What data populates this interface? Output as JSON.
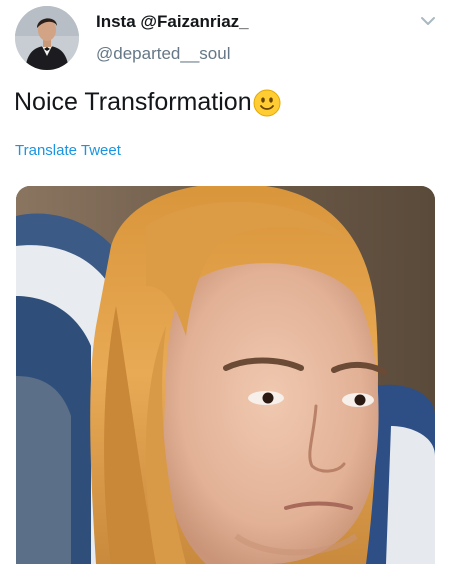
{
  "tweet": {
    "display_name": "Insta @Faizanriaz_",
    "handle": "@departed__soul",
    "text": "Noice Transformation",
    "emoji": "slightly-smiling-face-emoji",
    "translate_label": "Translate Tweet",
    "more_icon": "chevron-down-icon"
  },
  "colors": {
    "link": "#1b95e0",
    "secondary_text": "#657786",
    "primary_text": "#14171a"
  }
}
